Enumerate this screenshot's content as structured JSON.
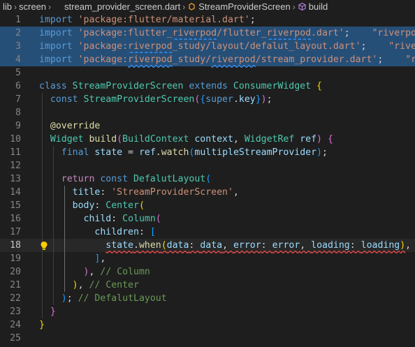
{
  "breadcrumb": {
    "items": [
      "lib",
      "screen",
      "stream_provider_screen.dart",
      "StreamProviderScreen",
      "build"
    ]
  },
  "editor": {
    "active_line": 18,
    "lines": [
      {
        "n": "1",
        "seg": [
          [
            "k",
            "import "
          ],
          [
            "s",
            "'package:flutter/material.dart'"
          ],
          [
            "p",
            ";"
          ]
        ]
      },
      {
        "n": "2",
        "seg": [
          [
            "k",
            "import "
          ],
          [
            "s",
            "'package:flutter_"
          ],
          [
            "s squig",
            "riverpod"
          ],
          [
            "s",
            "/flutter_"
          ],
          [
            "s squig",
            "riverpod"
          ],
          [
            "s",
            ".dart'"
          ],
          [
            "p",
            ";"
          ],
          [
            "s",
            "    \"riverpod\""
          ]
        ]
      },
      {
        "n": "3",
        "seg": [
          [
            "k",
            "import "
          ],
          [
            "s",
            "'package:"
          ],
          [
            "s squig",
            "riverpod"
          ],
          [
            "s",
            "_study/layout/defalut_layout.dart'"
          ],
          [
            "p",
            ";"
          ],
          [
            "s",
            "    \"riverp"
          ]
        ]
      },
      {
        "n": "4",
        "seg": [
          [
            "k",
            "import "
          ],
          [
            "s",
            "'package:"
          ],
          [
            "s squig",
            "riverpod"
          ],
          [
            "s",
            "_study/"
          ],
          [
            "s squig",
            "riverpod"
          ],
          [
            "s",
            "/stream_provider.dart'"
          ],
          [
            "p",
            ";"
          ],
          [
            "s",
            "    \"riv"
          ]
        ]
      },
      {
        "n": "5",
        "seg": []
      },
      {
        "n": "6",
        "seg": [
          [
            "k",
            "class "
          ],
          [
            "t",
            "StreamProviderScreen "
          ],
          [
            "k",
            "extends "
          ],
          [
            "t",
            "ConsumerWidget "
          ],
          [
            "b1",
            "{"
          ]
        ]
      },
      {
        "n": "7",
        "seg": [
          [
            "p",
            "  "
          ],
          [
            "k",
            "const "
          ],
          [
            "t",
            "StreamProviderScreen"
          ],
          [
            "b2",
            "("
          ],
          [
            "b3",
            "{"
          ],
          [
            "k",
            "super"
          ],
          [
            "p",
            "."
          ],
          [
            "v",
            "key"
          ],
          [
            "b3",
            "}"
          ],
          [
            "b2",
            ")"
          ],
          [
            "p",
            ";"
          ]
        ]
      },
      {
        "n": "8",
        "seg": []
      },
      {
        "n": "9",
        "seg": [
          [
            "p",
            "  "
          ],
          [
            "f",
            "@override"
          ]
        ]
      },
      {
        "n": "10",
        "seg": [
          [
            "p",
            "  "
          ],
          [
            "t",
            "Widget "
          ],
          [
            "f",
            "build"
          ],
          [
            "b2",
            "("
          ],
          [
            "t",
            "BuildContext "
          ],
          [
            "v",
            "context"
          ],
          [
            "p",
            ", "
          ],
          [
            "t",
            "WidgetRef "
          ],
          [
            "v",
            "ref"
          ],
          [
            "b2",
            ")"
          ],
          [
            "p",
            " "
          ],
          [
            "b2",
            "{"
          ]
        ]
      },
      {
        "n": "11",
        "seg": [
          [
            "p",
            "    "
          ],
          [
            "k",
            "final "
          ],
          [
            "v",
            "state "
          ],
          [
            "p",
            "= "
          ],
          [
            "v",
            "ref"
          ],
          [
            "p",
            "."
          ],
          [
            "f",
            "watch"
          ],
          [
            "b3",
            "("
          ],
          [
            "v",
            "multipleStreamProvider"
          ],
          [
            "b3",
            ")"
          ],
          [
            "p",
            ";"
          ]
        ]
      },
      {
        "n": "12",
        "seg": []
      },
      {
        "n": "13",
        "seg": [
          [
            "p",
            "    "
          ],
          [
            "ctl",
            "return "
          ],
          [
            "k",
            "const "
          ],
          [
            "t",
            "DefalutLayout"
          ],
          [
            "b3",
            "("
          ]
        ]
      },
      {
        "n": "14",
        "seg": [
          [
            "p",
            "      "
          ],
          [
            "v",
            "title"
          ],
          [
            "p",
            ": "
          ],
          [
            "s",
            "'StreamProviderScreen'"
          ],
          [
            "p",
            ","
          ]
        ]
      },
      {
        "n": "15",
        "seg": [
          [
            "p",
            "      "
          ],
          [
            "v",
            "body"
          ],
          [
            "p",
            ": "
          ],
          [
            "t",
            "Center"
          ],
          [
            "b1",
            "("
          ]
        ]
      },
      {
        "n": "16",
        "seg": [
          [
            "p",
            "        "
          ],
          [
            "v",
            "child"
          ],
          [
            "p",
            ": "
          ],
          [
            "t",
            "Column"
          ],
          [
            "b2",
            "("
          ]
        ]
      },
      {
        "n": "17",
        "seg": [
          [
            "p",
            "          "
          ],
          [
            "v",
            "children"
          ],
          [
            "p",
            ": "
          ],
          [
            "b3",
            "["
          ]
        ]
      },
      {
        "n": "18",
        "seg": [
          [
            "p",
            "            "
          ],
          [
            "v squig-err",
            "state"
          ],
          [
            "p squig-err",
            "."
          ],
          [
            "f squig-err",
            "when"
          ],
          [
            "b1 squig-err",
            "("
          ],
          [
            "v squig-err",
            "data"
          ],
          [
            "p squig-err",
            ": "
          ],
          [
            "v squig-err",
            "data"
          ],
          [
            "p squig-err",
            ", "
          ],
          [
            "v squig-err",
            "error"
          ],
          [
            "p squig-err",
            ": "
          ],
          [
            "v squig-err",
            "error"
          ],
          [
            "p squig-err",
            ", "
          ],
          [
            "v squig-err",
            "loading"
          ],
          [
            "p squig-err",
            ": "
          ],
          [
            "v squig-err",
            "loading"
          ],
          [
            "b1 squig-err",
            ")"
          ],
          [
            "p",
            ","
          ]
        ]
      },
      {
        "n": "19",
        "seg": [
          [
            "p",
            "          "
          ],
          [
            "b3",
            "]"
          ],
          [
            "p",
            ","
          ]
        ]
      },
      {
        "n": "20",
        "seg": [
          [
            "p",
            "        "
          ],
          [
            "b2",
            ")"
          ],
          [
            "p",
            ", "
          ],
          [
            "c",
            "// Column"
          ]
        ]
      },
      {
        "n": "21",
        "seg": [
          [
            "p",
            "      "
          ],
          [
            "b1",
            ")"
          ],
          [
            "p",
            ", "
          ],
          [
            "c",
            "// Center"
          ]
        ]
      },
      {
        "n": "22",
        "seg": [
          [
            "p",
            "    "
          ],
          [
            "b3",
            ")"
          ],
          [
            "p",
            "; "
          ],
          [
            "c",
            "// DefalutLayout"
          ]
        ]
      },
      {
        "n": "23",
        "seg": [
          [
            "p",
            "  "
          ],
          [
            "b2",
            "}"
          ]
        ]
      },
      {
        "n": "24",
        "seg": [
          [
            "b1",
            "}"
          ]
        ]
      },
      {
        "n": "25",
        "seg": []
      }
    ]
  },
  "colors": {
    "background": "#1e1e1e",
    "selection": "#264f78",
    "keyword": "#569cd6",
    "string": "#ce9178",
    "type": "#4ec9b0",
    "function": "#dcdcaa",
    "variable": "#9cdcfe",
    "comment": "#6a9955"
  },
  "icons": {
    "build_symbol": "method-cube-icon",
    "class_symbol": "class-icon",
    "lightbulb": "lightbulb-icon"
  }
}
